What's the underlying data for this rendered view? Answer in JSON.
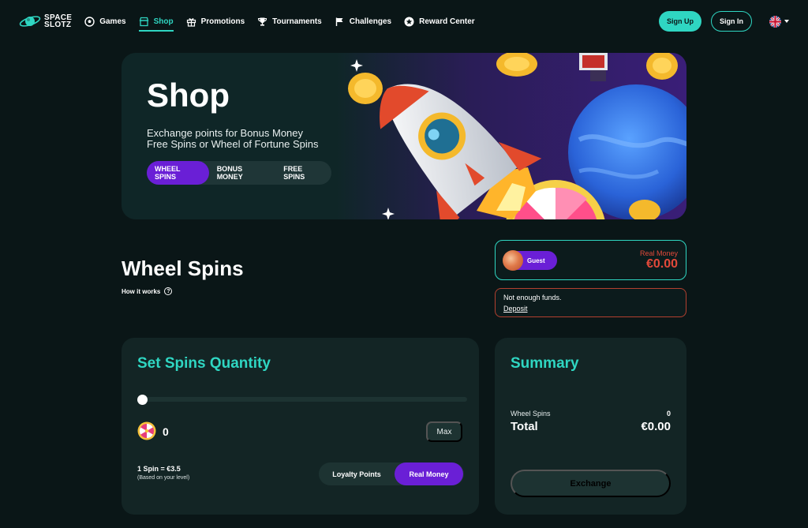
{
  "brand": {
    "line1": "SPACE",
    "line2": "SLOTZ"
  },
  "nav": {
    "items": [
      {
        "label": "Games",
        "icon": "soccer-ball-icon"
      },
      {
        "label": "Shop",
        "icon": "store-icon",
        "active": true
      },
      {
        "label": "Promotions",
        "icon": "gift-icon"
      },
      {
        "label": "Tournaments",
        "icon": "trophy-icon"
      },
      {
        "label": "Challenges",
        "icon": "flag-icon"
      },
      {
        "label": "Reward Center",
        "icon": "star-icon"
      }
    ],
    "signup": "Sign Up",
    "signin": "Sign In",
    "language_icon": "uk-flag-icon"
  },
  "hero": {
    "title": "Shop",
    "subtitle_line1": "Exchange points for Bonus Money",
    "subtitle_line2": "Free Spins or Wheel of Fortune Spins",
    "tabs": [
      "WHEEL SPINS",
      "BONUS MONEY",
      "FREE SPINS"
    ],
    "active_tab": "WHEEL SPINS"
  },
  "section": {
    "title": "Wheel Spins",
    "how_it_works": "How it works"
  },
  "balance": {
    "user": "Guest",
    "label": "Real Money",
    "amount": "€0.00"
  },
  "warning": {
    "text": "Not enough funds.",
    "link": "Deposit"
  },
  "quantity": {
    "title": "Set Spins Quantity",
    "slider_fraction": 0,
    "value": "0",
    "max_label": "Max",
    "rate": "1 Spin = €3.5",
    "rate_note": "(Based on your level)",
    "options": [
      "Loyalty Points",
      "Real Money"
    ],
    "selected_option": "Real Money"
  },
  "summary": {
    "title": "Summary",
    "row_label": "Wheel Spins",
    "row_value": "0",
    "total_label": "Total",
    "total_value": "€0.00",
    "button": "Exchange"
  },
  "colors": {
    "background": "#0a1617",
    "accent": "#2fd6c2",
    "purple": "#6a1fd6",
    "danger": "#e2493a"
  }
}
